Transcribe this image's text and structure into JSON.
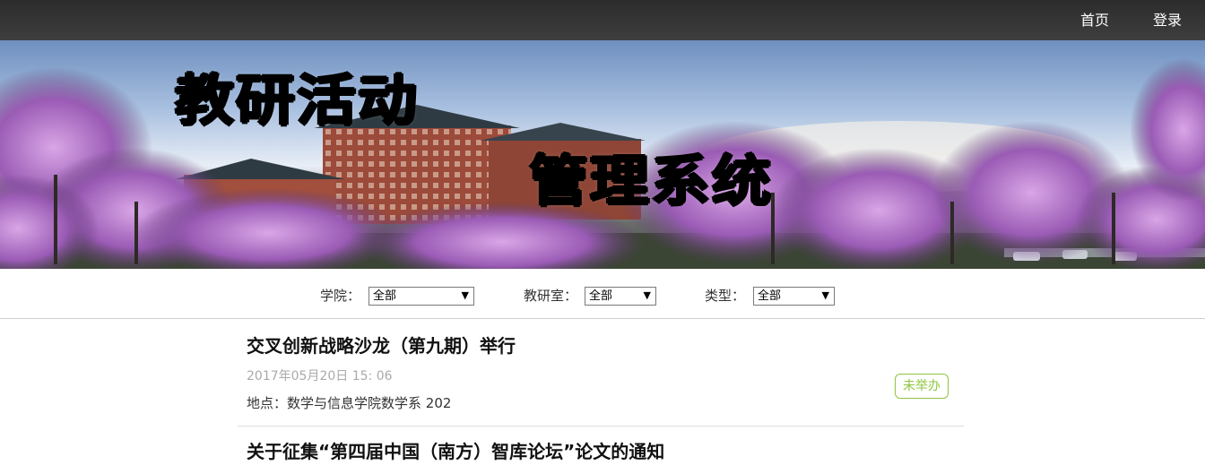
{
  "nav": {
    "home": "首页",
    "login": "登录"
  },
  "banner": {
    "line1": "教研活动",
    "line2": "管理系统"
  },
  "filters": [
    {
      "label": "学院：",
      "value": "全部"
    },
    {
      "label": "教研室：",
      "value": "全部"
    },
    {
      "label": "类型：",
      "value": "全部"
    }
  ],
  "activities": [
    {
      "title": "交叉创新战略沙龙（第九期）举行",
      "date": "2017年05月20日 15: 06",
      "place": "地点：数学与信息学院数学系 202",
      "status": "未举办"
    },
    {
      "title": "关于征集“第四届中国（南方）智库论坛”论文的通知"
    }
  ],
  "colors": {
    "status_green": "#8dc63f",
    "nav_bg": "#333333"
  }
}
